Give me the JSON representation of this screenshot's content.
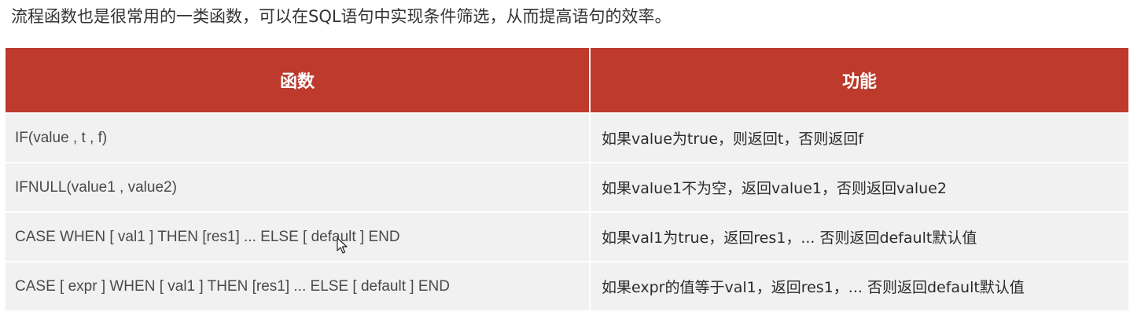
{
  "intro_text": "流程函数也是很常用的一类函数，可以在SQL语句中实现条件筛选，从而提高语句的效率。",
  "table": {
    "headers": [
      "函数",
      "功能"
    ],
    "rows": [
      [
        "IF(value , t , f)",
        "如果value为true，则返回t，否则返回f"
      ],
      [
        "IFNULL(value1 , value2)",
        "如果value1不为空，返回value1，否则返回value2"
      ],
      [
        "CASE  WHEN  [ val1 ]  THEN  [res1]  ... ELSE [ default ]  END",
        "如果val1为true，返回res1，... 否则返回default默认值"
      ],
      [
        "CASE [ expr ]  WHEN  [ val1 ]  THEN  [res1]  ... ELSE [ default ]  END",
        "如果expr的值等于val1，返回res1，... 否则返回default默认值"
      ]
    ]
  },
  "colors": {
    "header_bg": "#bd3a2c",
    "row_bg": "#f1f1f1"
  }
}
